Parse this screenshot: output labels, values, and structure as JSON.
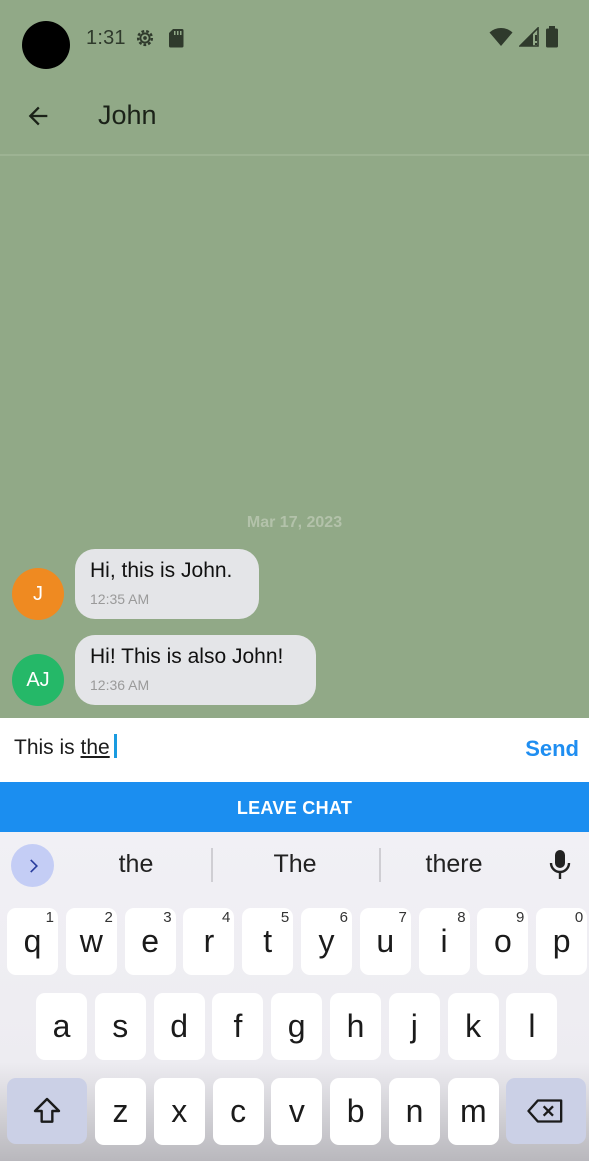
{
  "status_bar": {
    "time": "1:31",
    "icons": [
      "settings-gear-icon",
      "sd-card-icon",
      "wifi-icon",
      "cell-signal-icon",
      "battery-icon"
    ]
  },
  "app_bar": {
    "title": "John",
    "back_icon": "arrow-back-icon"
  },
  "chat": {
    "date_separator": "Mar 17, 2023",
    "messages": [
      {
        "avatar_initials": "J",
        "avatar_color": "#ef8a21",
        "text": "Hi, this is John.",
        "time": "12:35 AM"
      },
      {
        "avatar_initials": "AJ",
        "avatar_color": "#25b868",
        "text": "Hi! This is also John!",
        "time": "12:36 AM"
      }
    ]
  },
  "composer": {
    "value_prefix": "This is ",
    "value_underlined": "the",
    "send_label": "Send"
  },
  "leave_chat_label": "LEAVE CHAT",
  "keyboard": {
    "suggestions": [
      "the",
      "The",
      "there"
    ],
    "row1": [
      {
        "k": "q",
        "n": "1"
      },
      {
        "k": "w",
        "n": "2"
      },
      {
        "k": "e",
        "n": "3"
      },
      {
        "k": "r",
        "n": "4"
      },
      {
        "k": "t",
        "n": "5"
      },
      {
        "k": "y",
        "n": "6"
      },
      {
        "k": "u",
        "n": "7"
      },
      {
        "k": "i",
        "n": "8"
      },
      {
        "k": "o",
        "n": "9"
      },
      {
        "k": "p",
        "n": "0"
      }
    ],
    "row2": [
      "a",
      "s",
      "d",
      "f",
      "g",
      "h",
      "j",
      "k",
      "l"
    ],
    "row3": [
      "z",
      "x",
      "c",
      "v",
      "b",
      "n",
      "m"
    ]
  },
  "colors": {
    "header_bg": "#91a987",
    "send": "#1f8ef1",
    "leave_bg": "#1b8ef0",
    "bubble": "#e4e5e8"
  }
}
